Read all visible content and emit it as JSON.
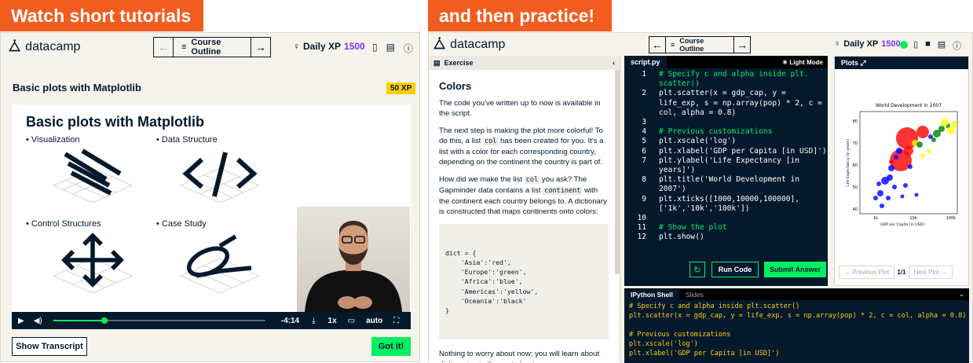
{
  "banners": {
    "left": "Watch short tutorials",
    "right": "and then practice!"
  },
  "left": {
    "logo": "datacamp",
    "outline_label": "Course Outline",
    "xp_label": "Daily XP",
    "xp_value": "1500",
    "lesson_title": "Basic plots with Matplotlib",
    "xp_badge": "50 XP",
    "slide_title": "Basic plots with Matplotlib",
    "topics": [
      "Visualization",
      "Data Structure",
      "Control Structures",
      "Case Study"
    ],
    "player": {
      "time": "-4:14",
      "speed": "1x",
      "quality": "auto",
      "progress": 0.24
    },
    "show_transcript": "Show Transcript",
    "got_it": "Got it!"
  },
  "right": {
    "logo": "datacamp",
    "outline_label": "Course Outline",
    "xp_label": "Daily XP",
    "xp_value": "1500",
    "exercise_tab": "Exercise",
    "exercise_title": "Colors",
    "para1": "The code you've written up to now is available in the script.",
    "para2": {
      "a": "The next step is making the plot more colorful! To do this, a list ",
      "code": "col",
      "b": " has been created for you. It's a list with a color for each corresponding country, depending on the continent the country is part of."
    },
    "para3": {
      "a": "How did we make the list ",
      "code1": "col",
      "b": " you ask? The Gapminder data contains a list ",
      "code2": "continent",
      "c": " with the continent each country belongs to. A dictionary is constructed that maps continents onto colors:"
    },
    "dict_lines": [
      "dict = {",
      "    'Asia':'red',",
      "    'Europe':'green',",
      "    'Africa':'blue',",
      "    'Americas':'yellow',",
      "    'Oceania':'black'",
      "}"
    ],
    "para4": "Nothing to worry about now; you will learn about dictionaries in the next chapter.",
    "script_tab": "script.py",
    "light_mode": "Light Mode",
    "code_lines": [
      {
        "n": "1",
        "t": "# Specify c and alpha inside plt."
      },
      {
        "n": "",
        "t": "scatter()"
      },
      {
        "n": "2",
        "t": "plt.scatter(x = gdp_cap, y ="
      },
      {
        "n": "",
        "t": "life_exp, s = np.array(pop) * 2, c ="
      },
      {
        "n": "",
        "t": "col, alpha = 0.8)"
      },
      {
        "n": "3",
        "t": ""
      },
      {
        "n": "4",
        "t": "# Previous customizations"
      },
      {
        "n": "5",
        "t": "plt.xscale('log')"
      },
      {
        "n": "6",
        "t": "plt.xlabel('GDP per Capita [in USD]')"
      },
      {
        "n": "7",
        "t": "plt.ylabel('Life Expectancy [in"
      },
      {
        "n": "",
        "t": "years]')"
      },
      {
        "n": "8",
        "t": "plt.title('World Development in"
      },
      {
        "n": "",
        "t": "2007')"
      },
      {
        "n": "9",
        "t": "plt.xticks([1000,10000,100000],"
      },
      {
        "n": "",
        "t": "['1k','10k','100k'])"
      },
      {
        "n": "10",
        "t": ""
      },
      {
        "n": "11",
        "t": "# Show the plot"
      },
      {
        "n": "12",
        "t": "plt.show()"
      }
    ],
    "run_code": "Run Code",
    "submit": "Submit Answer",
    "plots_tab": "Plots",
    "plot_title": "World Development in 2007",
    "plot_xlabel": "GDP per Capita [in USD]",
    "plot_ylabel": "Life Expectancy [in years]",
    "plot_yticks": [
      "80",
      "70",
      "60",
      "50",
      "40"
    ],
    "plot_xticks": [
      "1k",
      "10k",
      "100k"
    ],
    "prev_plot": "Previous Plot",
    "plot_count": "1/1",
    "next_plot": "Next Plot",
    "shell_tab": "IPython Shell",
    "slides_tab": "Slides",
    "shell_lines": [
      "# Specify c and alpha inside plt.scatter()",
      "plt.scatter(x = gdp_cap, y = life_exp, s = np.array(pop) * 2, c = col, alpha = 0.8)",
      "",
      "# Previous customizations",
      "plt.xscale('log')",
      "plt.xlabel('GDP per Capita [in USD]')"
    ]
  },
  "colors": {
    "orange": "#f25d1f",
    "navy": "#05192d",
    "green": "#03ef62",
    "yellow": "#fcce0d",
    "purple": "#7933ff",
    "editor_bg": "#05192d"
  }
}
